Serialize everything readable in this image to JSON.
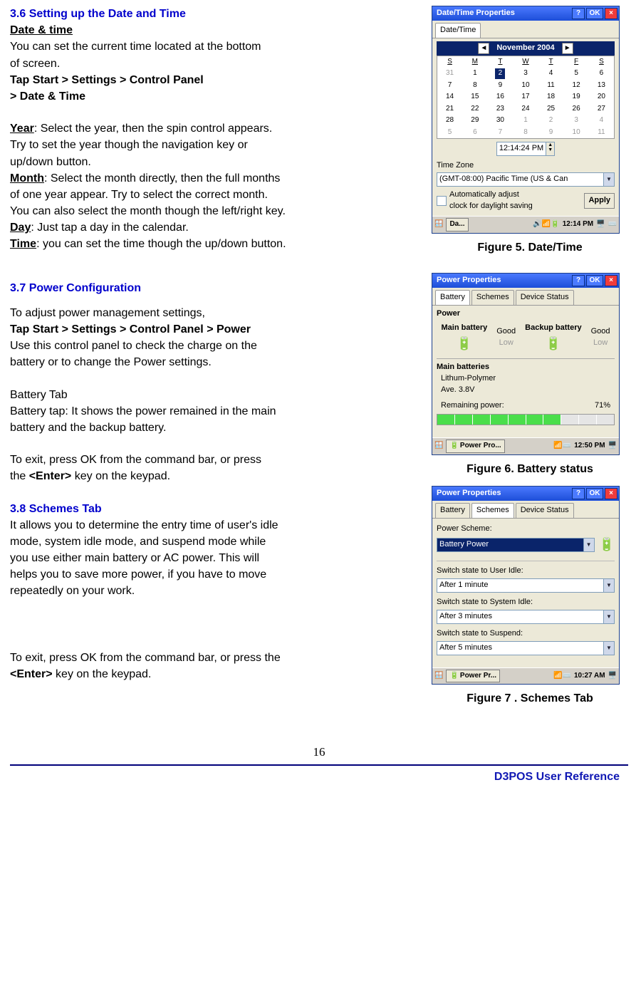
{
  "sections": {
    "sec36_title": "3.6 Setting up the Date and Time",
    "sec37_title": "3.7 Power Configuration",
    "sec38_title": "3.8 Schemes Tab"
  },
  "text": {
    "date_time_label": "Date & time",
    "date_time_p1a": "You can set the current time located at the bottom",
    "date_time_p1b": "of screen.",
    "nav1": "Tap Start > Settings > Control Panel",
    "nav2": "> Date & Time",
    "year_lbl": "Year",
    "year_rest": ": Select the year, then the spin control appears.",
    "year_p2": "Try to set the year though the navigation key or",
    "year_p3": "up/down button.",
    "month_lbl": "Month",
    "month_rest": ": Select the month directly, then the full months",
    "month_p2": "of one year appear. Try to select the correct month.",
    "month_p3": "You can also select the month though the left/right key.",
    "day_lbl": "Day",
    "day_rest": ": Just tap a day in the calendar.",
    "time_lbl": "Time",
    "time_rest": ": you can set the time though the up/down button.",
    "pwr_p1": "To adjust power management settings,",
    "pwr_nav": "Tap Start > Settings > Control Panel > Power",
    "pwr_p2a": "Use this control panel to check the charge on the",
    "pwr_p2b": "battery or to change the Power settings.",
    "battab_lbl": "Battery Tab",
    "battab_p1a": "Battery tap: It shows the power remained in the main",
    "battab_p1b": "battery and the backup battery.",
    "exit_p1a": "To exit, press OK from the command bar, or press",
    "exit_p1b_pre": "the ",
    "exit_enter": "<Enter>",
    "exit_p1b_post": " key on the keypad.",
    "scheme_p1": "It allows you to determine the entry time of user's idle",
    "scheme_p2": "mode, system idle mode, and suspend mode while",
    "scheme_p3": "you use either main battery or AC power. This will",
    "scheme_p4": "helps you to save more power, if you have to move",
    "scheme_p5": "repeatedly on your work.",
    "exit2_p1a": "To exit, press OK from the command bar, or press the",
    "exit2_enter": "<Enter>",
    "exit2_p1b": " key on the keypad."
  },
  "fig5": {
    "caption": "Figure 5. Date/Time",
    "win_title": "Date/Time Properties",
    "help": "?",
    "ok": "OK",
    "close": "×",
    "tab": "Date/Time",
    "cal_label": "November 2004",
    "days": [
      "S",
      "M",
      "T",
      "W",
      "T",
      "F",
      "S"
    ],
    "grid": [
      [
        {
          "v": "31",
          "dim": true
        },
        {
          "v": "1"
        },
        {
          "v": "2",
          "sel": true
        },
        {
          "v": "3"
        },
        {
          "v": "4"
        },
        {
          "v": "5"
        },
        {
          "v": "6"
        }
      ],
      [
        {
          "v": "7"
        },
        {
          "v": "8"
        },
        {
          "v": "9"
        },
        {
          "v": "10"
        },
        {
          "v": "11"
        },
        {
          "v": "12"
        },
        {
          "v": "13"
        }
      ],
      [
        {
          "v": "14"
        },
        {
          "v": "15"
        },
        {
          "v": "16"
        },
        {
          "v": "17"
        },
        {
          "v": "18"
        },
        {
          "v": "19"
        },
        {
          "v": "20"
        }
      ],
      [
        {
          "v": "21"
        },
        {
          "v": "22"
        },
        {
          "v": "23"
        },
        {
          "v": "24"
        },
        {
          "v": "25"
        },
        {
          "v": "26"
        },
        {
          "v": "27"
        }
      ],
      [
        {
          "v": "28"
        },
        {
          "v": "29"
        },
        {
          "v": "30"
        },
        {
          "v": "1",
          "dim": true
        },
        {
          "v": "2",
          "dim": true
        },
        {
          "v": "3",
          "dim": true
        },
        {
          "v": "4",
          "dim": true
        }
      ],
      [
        {
          "v": "5",
          "dim": true
        },
        {
          "v": "6",
          "dim": true
        },
        {
          "v": "7",
          "dim": true
        },
        {
          "v": "8",
          "dim": true
        },
        {
          "v": "9",
          "dim": true
        },
        {
          "v": "10",
          "dim": true
        },
        {
          "v": "11",
          "dim": true
        }
      ]
    ],
    "time_value": "12:14:24 PM",
    "tz_label": "Time Zone",
    "tz_value": "(GMT-08:00) Pacific Time (US & Can",
    "dst_label1": "Automatically adjust",
    "dst_label2": "clock for daylight saving",
    "apply": "Apply",
    "task_app": "Da...",
    "task_clock": "12:14 PM"
  },
  "fig6": {
    "caption": "Figure 6. Battery status",
    "win_title": "Power Properties",
    "help": "?",
    "ok": "OK",
    "close": "×",
    "tabs": [
      "Battery",
      "Schemes",
      "Device Status"
    ],
    "power_hdr": "Power",
    "main_b": "Main battery",
    "backup_b": "Backup battery",
    "good": "Good",
    "low": "Low",
    "mainbat_hdr": "Main batteries",
    "line_type": "Lithum-Polymer",
    "line_volt": "Ave. 3.8V",
    "rem_label": "Remaining power:",
    "rem_val": "71%",
    "task_app": "Power Pro...",
    "task_clock": "12:50 PM"
  },
  "fig7": {
    "caption": "Figure 7 . Schemes Tab",
    "win_title": "Power Properties",
    "help": "?",
    "ok": "OK",
    "close": "×",
    "tabs": [
      "Battery",
      "Schemes",
      "Device Status"
    ],
    "scheme_label": "Power Scheme:",
    "scheme_value": "Battery Power",
    "s1_label": "Switch state to User Idle:",
    "s1_val": "After 1 minute",
    "s2_label": "Switch state to System Idle:",
    "s2_val": "After 3 minutes",
    "s3_label": "Switch state to Suspend:",
    "s3_val": "After 5 minutes",
    "task_app": "Power Pr...",
    "task_clock": "10:27 AM"
  },
  "page_number": "16",
  "footer": "D3POS User Reference"
}
